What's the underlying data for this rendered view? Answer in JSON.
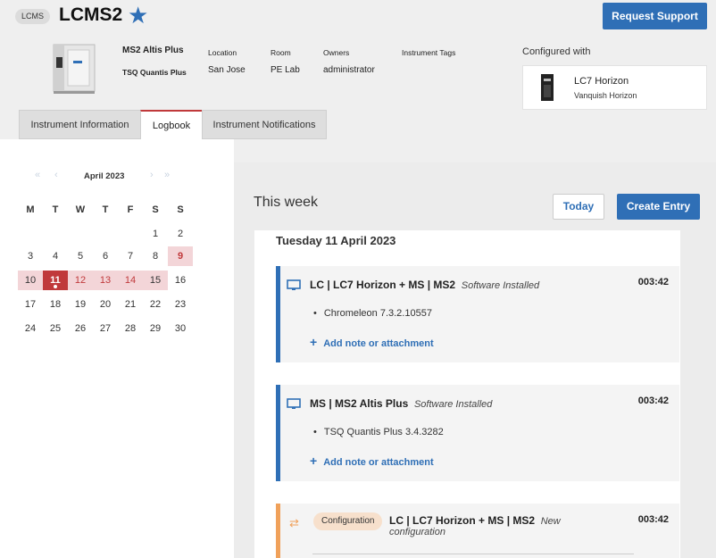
{
  "header": {
    "badge": "LCMS",
    "title": "LCMS2",
    "request_support": "Request Support"
  },
  "instrument": {
    "name": "MS2 Altis Plus",
    "software": "TSQ Quantis Plus",
    "location_label": "Location",
    "location": "San Jose",
    "room_label": "Room",
    "room": "PE Lab",
    "owners_label": "Owners",
    "owners": "administrator",
    "tags_label": "Instrument Tags"
  },
  "configured": {
    "label": "Configured with",
    "name": "LC7 Horizon",
    "model": "Vanquish Horizon"
  },
  "tabs": [
    {
      "label": "Instrument Information"
    },
    {
      "label": "Logbook"
    },
    {
      "label": "Instrument Notifications"
    }
  ],
  "calendar": {
    "month": "April 2023",
    "dow": [
      "M",
      "T",
      "W",
      "T",
      "F",
      "S",
      "S"
    ],
    "rows": [
      [
        "",
        "",
        "",
        "",
        "",
        "1",
        "2"
      ],
      [
        "3",
        "4",
        "5",
        "6",
        "7",
        "8",
        "9"
      ],
      [
        "10",
        "11",
        "12",
        "13",
        "14",
        "15",
        "16"
      ],
      [
        "17",
        "18",
        "19",
        "20",
        "21",
        "22",
        "23"
      ],
      [
        "24",
        "25",
        "26",
        "27",
        "28",
        "29",
        "30"
      ]
    ]
  },
  "logbook": {
    "week_title": "This week",
    "today_button": "Today",
    "create_button": "Create Entry",
    "date_label": "Tuesday 11 April 2023",
    "entries": [
      {
        "title": "LC | LC7 Horizon + MS | MS2",
        "status": "Software Installed",
        "time": "003:42",
        "bullet": "Chromeleon 7.3.2.10557",
        "add": "Add note or attachment"
      },
      {
        "title": "MS | MS2 Altis Plus",
        "status": "Software Installed",
        "time": "003:42",
        "bullet": "TSQ Quantis Plus 3.4.3282",
        "add": "Add note or attachment"
      },
      {
        "badge": "Configuration",
        "title": "LC | LC7 Horizon + MS | MS2",
        "status_line1": "New",
        "status_line2": "configuration",
        "time": "003:42"
      }
    ]
  },
  "colors": {
    "accent": "#2f6fb6",
    "today": "#c0393b",
    "week_highlight": "#f3d5d8",
    "config_border": "#f0a15a"
  }
}
